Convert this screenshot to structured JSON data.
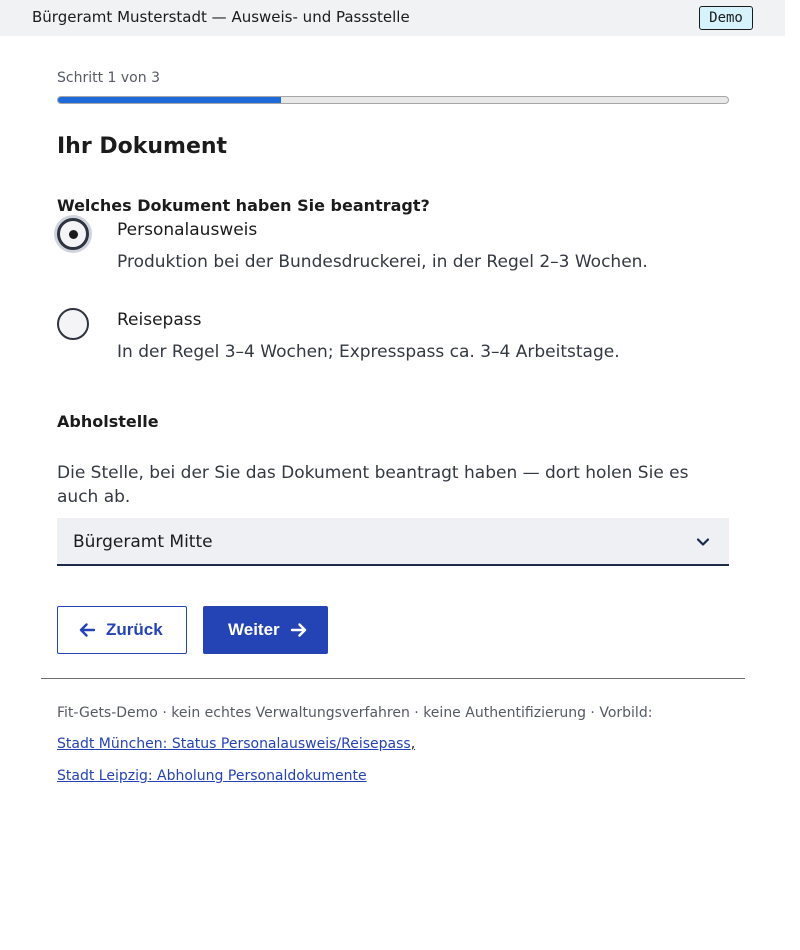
{
  "topbar": {
    "title": "Bürgeramt Musterstadt — Ausweis- und Passstelle",
    "badge": "Demo"
  },
  "progress": {
    "step_text": "Schritt 1 von 3",
    "fraction": 0.333
  },
  "page": {
    "heading": "Ihr Dokument"
  },
  "document_question": {
    "legend": "Welches Dokument haben Sie beantragt?",
    "options": [
      {
        "label": "Personalausweis",
        "hint": "Produktion bei der Bundesdruckerei, in der Regel 2–3 Wochen.",
        "checked": true
      },
      {
        "label": "Reisepass",
        "hint": "In der Regel 3–4 Wochen; Expresspass ca. 3–4 Arbeitstage.",
        "checked": false
      }
    ]
  },
  "pickup": {
    "label": "Abholstelle",
    "hint": "Die Stelle, bei der Sie das Dokument beantragt haben — dort holen Sie es auch ab.",
    "selected": "Bürgeramt Mitte"
  },
  "buttons": {
    "back": "Zurück",
    "next": "Weiter"
  },
  "footer": {
    "text": "Fit-Gets-Demo · kein echtes Verwaltungsverfahren · keine Authentifizierung · Vorbild:",
    "link1": "Stadt München: Status Personalausweis/Reisepass",
    "comma": ",",
    "link2": "Stadt Leipzig: Abholung Personaldokumente"
  },
  "colors": {
    "primary": "#2443b5",
    "progress": "#1e6ad8",
    "badge_bg": "#d6f3fb",
    "topbar_bg": "#f1f2f4"
  }
}
